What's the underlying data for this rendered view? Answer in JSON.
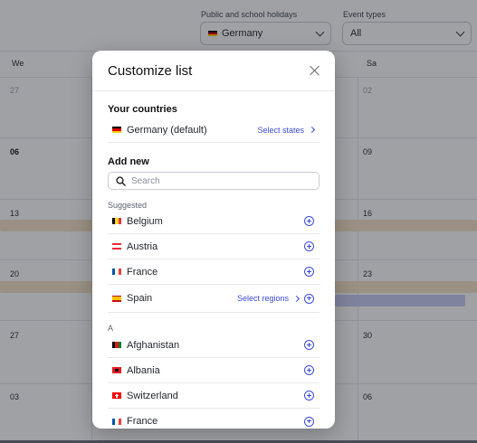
{
  "filters": {
    "holidays": {
      "label": "Public and school holidays",
      "value": "Germany"
    },
    "events": {
      "label": "Event types",
      "value": "All"
    }
  },
  "calendar": {
    "day_names": [
      "We",
      "Sa"
    ],
    "dates": {
      "r1_left": "27",
      "r1_right": "02",
      "r2_left": "06",
      "r2_right": "09",
      "r3_left": "13",
      "r3_right": "16",
      "r4_left": "20",
      "r4_right": "23",
      "r5_left": "27",
      "r5_right": "30",
      "r6_left": "03",
      "r6_right": "06"
    }
  },
  "modal": {
    "title": "Customize list",
    "your_countries": {
      "heading": "Your countries",
      "items": [
        {
          "name": "Germany (default)",
          "action": "Select states"
        }
      ]
    },
    "add_new": {
      "heading": "Add new",
      "search_placeholder": "Search",
      "suggested_label": "Suggested",
      "suggested": [
        {
          "name": "Belgium"
        },
        {
          "name": "Austria"
        },
        {
          "name": "France"
        },
        {
          "name": "Spain",
          "action": "Select regions"
        }
      ],
      "group_label": "A",
      "list": [
        {
          "name": "Afghanistan"
        },
        {
          "name": "Albania"
        },
        {
          "name": "Switzerland"
        },
        {
          "name": "France"
        }
      ]
    }
  },
  "colors": {
    "accent": "#3b4be0",
    "holiday_bar": "#f5e2c4",
    "event_bar": "#c9ccf2"
  }
}
